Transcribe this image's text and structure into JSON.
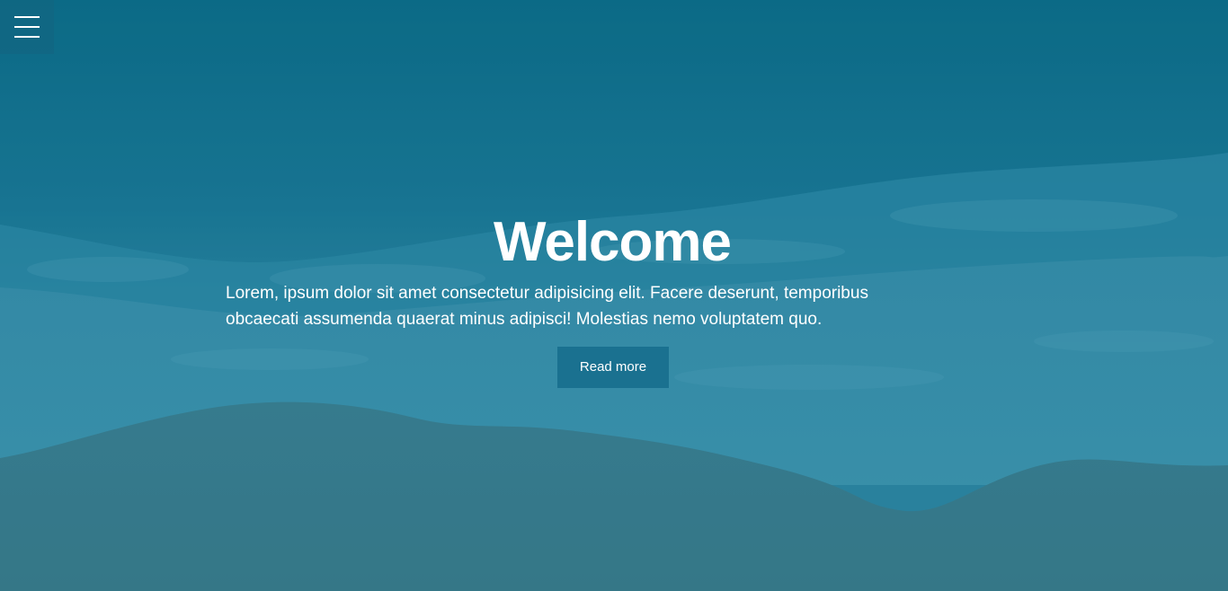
{
  "nav": {
    "menu_icon": "hamburger-menu-icon"
  },
  "hero": {
    "title": "Welcome",
    "text": "Lorem, ipsum dolor sit amet consectetur adipisicing elit. Facere deserunt, temporibus obcaecati assumenda quaerat minus adipisci! Molestias nemo voluptatem quo.",
    "button_label": "Read more"
  },
  "colors": {
    "deep_sea": "#0d6c8a",
    "surf": "#3a8ca6",
    "sand_overlay": "#3b7b8c",
    "button_bg": "#1a7190",
    "text": "#ffffff"
  }
}
